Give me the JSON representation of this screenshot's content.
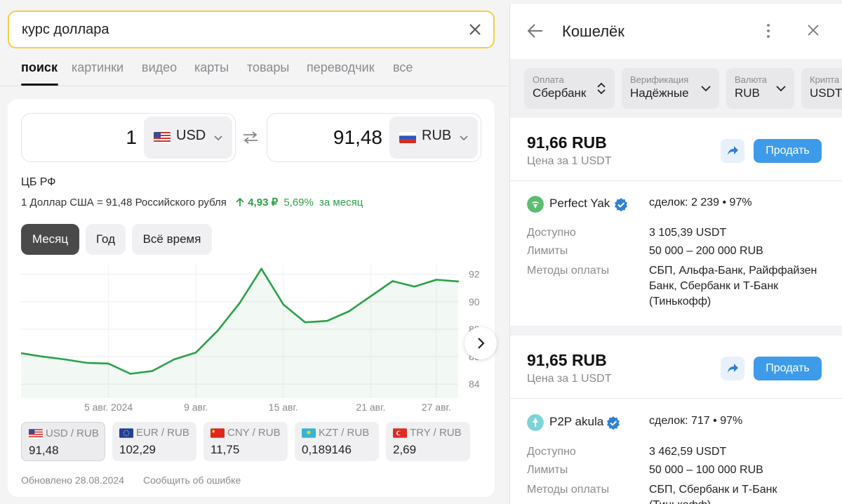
{
  "search": {
    "query": "курс доллара"
  },
  "tabs": [
    "поиск",
    "картинки",
    "видео",
    "карты",
    "товары",
    "переводчик",
    "все"
  ],
  "converter": {
    "from_amount": "1",
    "from_code": "USD",
    "to_amount": "91,48",
    "to_code": "RUB"
  },
  "rate": {
    "source": "ЦБ РФ",
    "text": "1 Доллар США = 91,48 Российского рубля",
    "change_abs": "4,93 ₽",
    "change_pct": "5,69%",
    "period_text": "за месяц"
  },
  "periods": [
    "Месяц",
    "Год",
    "Всё время"
  ],
  "chart_data": {
    "type": "area",
    "x": [
      "29.07",
      "31.07",
      "01.08",
      "02.08",
      "05.08",
      "06.08",
      "07.08",
      "08.08",
      "09.08",
      "12.08",
      "13.08",
      "14.08",
      "15.08",
      "16.08",
      "19.08",
      "20.08",
      "21.08",
      "22.08",
      "23.08",
      "27.08",
      "28.08"
    ],
    "x_ticks": [
      "5 авг. 2024",
      "9 авг.",
      "15 авг.",
      "21 авг.",
      "27 авг."
    ],
    "values": [
      86.25,
      86.0,
      85.8,
      85.55,
      85.5,
      84.75,
      84.95,
      85.8,
      86.3,
      87.9,
      89.9,
      92.4,
      89.8,
      88.5,
      88.6,
      89.3,
      90.4,
      91.5,
      91.1,
      91.6,
      91.48
    ],
    "y_ticks": [
      84,
      86,
      88,
      90,
      92
    ],
    "ylim": [
      83.5,
      92.7
    ],
    "grid": true,
    "color": "#2aa147"
  },
  "pairs": [
    {
      "name": "USD / RUB",
      "value": "91,48"
    },
    {
      "name": "EUR / RUB",
      "value": "102,29"
    },
    {
      "name": "CNY / RUB",
      "value": "11,75"
    },
    {
      "name": "KZT / RUB",
      "value": "0,189146"
    },
    {
      "name": "TRY / RUB",
      "value": "2,69"
    }
  ],
  "footer": {
    "updated": "Обновлено 28.08.2024",
    "report": "Сообщить об ошибке"
  },
  "wallet": {
    "title": "Кошелёк",
    "filters": [
      {
        "label": "Оплата",
        "value": "Сбербанк"
      },
      {
        "label": "Верификация",
        "value": "Надёжные"
      },
      {
        "label": "Валюта",
        "value": "RUB"
      },
      {
        "label": "Крипта",
        "value": "USDT"
      }
    ],
    "sell_label": "Продать",
    "labels": {
      "available": "Доступно",
      "limits": "Лимиты",
      "methods": "Методы оплаты"
    },
    "offers": [
      {
        "price": "91,66 RUB",
        "per": "Цена за 1 USDT",
        "seller": "Perfect Yak",
        "deals": "сделок: 2 239 • 97%",
        "available": "3 105,39 USDT",
        "limits": "50 000 – 200 000 RUB",
        "methods": "СБП, Альфа-Банк, Райффайзен Банк, Сбербанк и Т-Банк (Тинькофф)"
      },
      {
        "price": "91,65 RUB",
        "per": "Цена за 1 USDT",
        "seller": "P2P akula",
        "deals": "сделок: 717 • 97%",
        "available": "3 462,59 USDT",
        "limits": "50 000 – 100 000 RUB",
        "methods": "СБП, Сбербанк и Т-Банк (Тинькофф)"
      }
    ]
  }
}
